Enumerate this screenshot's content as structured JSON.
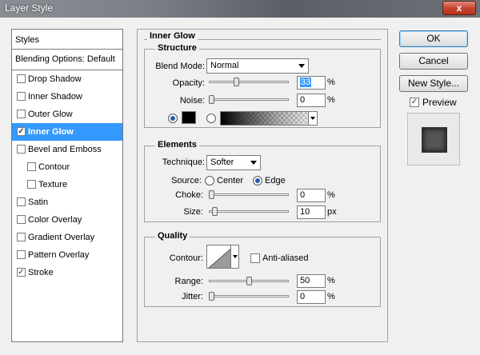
{
  "window": {
    "title": "Layer Style",
    "close_label": "x"
  },
  "styles_panel": {
    "header": "Styles",
    "blending": "Blending Options: Default",
    "items": [
      {
        "label": "Drop Shadow",
        "checked": false,
        "selected": false,
        "indent": false
      },
      {
        "label": "Inner Shadow",
        "checked": false,
        "selected": false,
        "indent": false
      },
      {
        "label": "Outer Glow",
        "checked": false,
        "selected": false,
        "indent": false
      },
      {
        "label": "Inner Glow",
        "checked": true,
        "selected": true,
        "indent": false
      },
      {
        "label": "Bevel and Emboss",
        "checked": false,
        "selected": false,
        "indent": false
      },
      {
        "label": "Contour",
        "checked": false,
        "selected": false,
        "indent": true
      },
      {
        "label": "Texture",
        "checked": false,
        "selected": false,
        "indent": true
      },
      {
        "label": "Satin",
        "checked": false,
        "selected": false,
        "indent": false
      },
      {
        "label": "Color Overlay",
        "checked": false,
        "selected": false,
        "indent": false
      },
      {
        "label": "Gradient Overlay",
        "checked": false,
        "selected": false,
        "indent": false
      },
      {
        "label": "Pattern Overlay",
        "checked": false,
        "selected": false,
        "indent": false
      },
      {
        "label": "Stroke",
        "checked": true,
        "selected": false,
        "indent": false
      }
    ]
  },
  "inner_glow": {
    "title": "Inner Glow",
    "structure": {
      "title": "Structure",
      "blend_mode_label": "Blend Mode:",
      "blend_mode": "Normal",
      "opacity_label": "Opacity:",
      "opacity": "33",
      "opacity_pct": 33,
      "noise_label": "Noise:",
      "noise": "0",
      "noise_pct": 0,
      "percent": "%"
    },
    "elements": {
      "title": "Elements",
      "technique_label": "Technique:",
      "technique": "Softer",
      "source_label": "Source:",
      "source_center": "Center",
      "source_edge": "Edge",
      "choke_label": "Choke:",
      "choke": "0",
      "choke_pct": 0,
      "size_label": "Size:",
      "size": "10",
      "size_pct": 4,
      "percent": "%",
      "px": "px"
    },
    "quality": {
      "title": "Quality",
      "contour_label": "Contour:",
      "anti_aliased_label": "Anti-aliased",
      "range_label": "Range:",
      "range": "50",
      "range_pct": 50,
      "jitter_label": "Jitter:",
      "jitter": "0",
      "jitter_pct": 0,
      "percent": "%"
    }
  },
  "buttons": {
    "ok": "OK",
    "cancel": "Cancel",
    "new_style": "New Style...",
    "preview_label": "Preview",
    "preview_checked": true
  }
}
